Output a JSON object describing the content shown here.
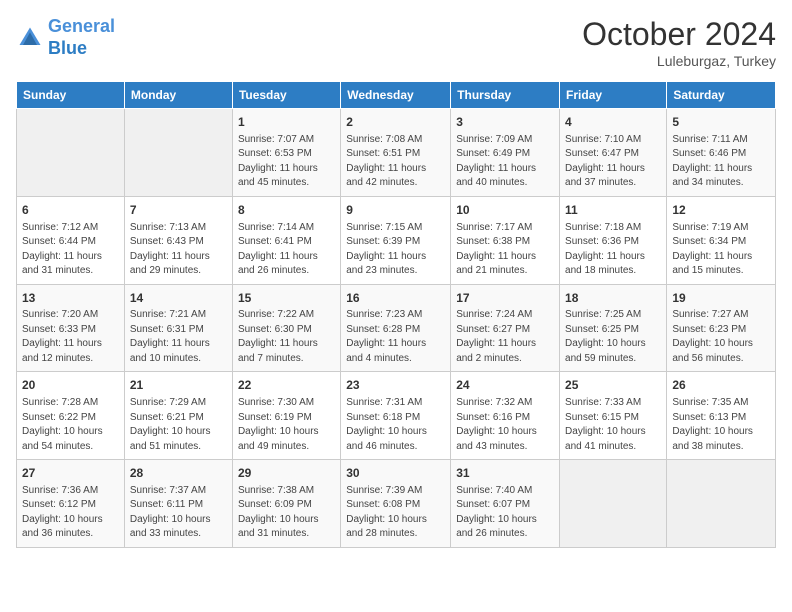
{
  "header": {
    "logo_line1": "General",
    "logo_line2": "Blue",
    "month": "October 2024",
    "location": "Luleburgaz, Turkey"
  },
  "weekdays": [
    "Sunday",
    "Monday",
    "Tuesday",
    "Wednesday",
    "Thursday",
    "Friday",
    "Saturday"
  ],
  "weeks": [
    [
      {
        "day": "",
        "info": ""
      },
      {
        "day": "",
        "info": ""
      },
      {
        "day": "1",
        "info": "Sunrise: 7:07 AM\nSunset: 6:53 PM\nDaylight: 11 hours and 45 minutes."
      },
      {
        "day": "2",
        "info": "Sunrise: 7:08 AM\nSunset: 6:51 PM\nDaylight: 11 hours and 42 minutes."
      },
      {
        "day": "3",
        "info": "Sunrise: 7:09 AM\nSunset: 6:49 PM\nDaylight: 11 hours and 40 minutes."
      },
      {
        "day": "4",
        "info": "Sunrise: 7:10 AM\nSunset: 6:47 PM\nDaylight: 11 hours and 37 minutes."
      },
      {
        "day": "5",
        "info": "Sunrise: 7:11 AM\nSunset: 6:46 PM\nDaylight: 11 hours and 34 minutes."
      }
    ],
    [
      {
        "day": "6",
        "info": "Sunrise: 7:12 AM\nSunset: 6:44 PM\nDaylight: 11 hours and 31 minutes."
      },
      {
        "day": "7",
        "info": "Sunrise: 7:13 AM\nSunset: 6:43 PM\nDaylight: 11 hours and 29 minutes."
      },
      {
        "day": "8",
        "info": "Sunrise: 7:14 AM\nSunset: 6:41 PM\nDaylight: 11 hours and 26 minutes."
      },
      {
        "day": "9",
        "info": "Sunrise: 7:15 AM\nSunset: 6:39 PM\nDaylight: 11 hours and 23 minutes."
      },
      {
        "day": "10",
        "info": "Sunrise: 7:17 AM\nSunset: 6:38 PM\nDaylight: 11 hours and 21 minutes."
      },
      {
        "day": "11",
        "info": "Sunrise: 7:18 AM\nSunset: 6:36 PM\nDaylight: 11 hours and 18 minutes."
      },
      {
        "day": "12",
        "info": "Sunrise: 7:19 AM\nSunset: 6:34 PM\nDaylight: 11 hours and 15 minutes."
      }
    ],
    [
      {
        "day": "13",
        "info": "Sunrise: 7:20 AM\nSunset: 6:33 PM\nDaylight: 11 hours and 12 minutes."
      },
      {
        "day": "14",
        "info": "Sunrise: 7:21 AM\nSunset: 6:31 PM\nDaylight: 11 hours and 10 minutes."
      },
      {
        "day": "15",
        "info": "Sunrise: 7:22 AM\nSunset: 6:30 PM\nDaylight: 11 hours and 7 minutes."
      },
      {
        "day": "16",
        "info": "Sunrise: 7:23 AM\nSunset: 6:28 PM\nDaylight: 11 hours and 4 minutes."
      },
      {
        "day": "17",
        "info": "Sunrise: 7:24 AM\nSunset: 6:27 PM\nDaylight: 11 hours and 2 minutes."
      },
      {
        "day": "18",
        "info": "Sunrise: 7:25 AM\nSunset: 6:25 PM\nDaylight: 10 hours and 59 minutes."
      },
      {
        "day": "19",
        "info": "Sunrise: 7:27 AM\nSunset: 6:23 PM\nDaylight: 10 hours and 56 minutes."
      }
    ],
    [
      {
        "day": "20",
        "info": "Sunrise: 7:28 AM\nSunset: 6:22 PM\nDaylight: 10 hours and 54 minutes."
      },
      {
        "day": "21",
        "info": "Sunrise: 7:29 AM\nSunset: 6:21 PM\nDaylight: 10 hours and 51 minutes."
      },
      {
        "day": "22",
        "info": "Sunrise: 7:30 AM\nSunset: 6:19 PM\nDaylight: 10 hours and 49 minutes."
      },
      {
        "day": "23",
        "info": "Sunrise: 7:31 AM\nSunset: 6:18 PM\nDaylight: 10 hours and 46 minutes."
      },
      {
        "day": "24",
        "info": "Sunrise: 7:32 AM\nSunset: 6:16 PM\nDaylight: 10 hours and 43 minutes."
      },
      {
        "day": "25",
        "info": "Sunrise: 7:33 AM\nSunset: 6:15 PM\nDaylight: 10 hours and 41 minutes."
      },
      {
        "day": "26",
        "info": "Sunrise: 7:35 AM\nSunset: 6:13 PM\nDaylight: 10 hours and 38 minutes."
      }
    ],
    [
      {
        "day": "27",
        "info": "Sunrise: 7:36 AM\nSunset: 6:12 PM\nDaylight: 10 hours and 36 minutes."
      },
      {
        "day": "28",
        "info": "Sunrise: 7:37 AM\nSunset: 6:11 PM\nDaylight: 10 hours and 33 minutes."
      },
      {
        "day": "29",
        "info": "Sunrise: 7:38 AM\nSunset: 6:09 PM\nDaylight: 10 hours and 31 minutes."
      },
      {
        "day": "30",
        "info": "Sunrise: 7:39 AM\nSunset: 6:08 PM\nDaylight: 10 hours and 28 minutes."
      },
      {
        "day": "31",
        "info": "Sunrise: 7:40 AM\nSunset: 6:07 PM\nDaylight: 10 hours and 26 minutes."
      },
      {
        "day": "",
        "info": ""
      },
      {
        "day": "",
        "info": ""
      }
    ]
  ]
}
